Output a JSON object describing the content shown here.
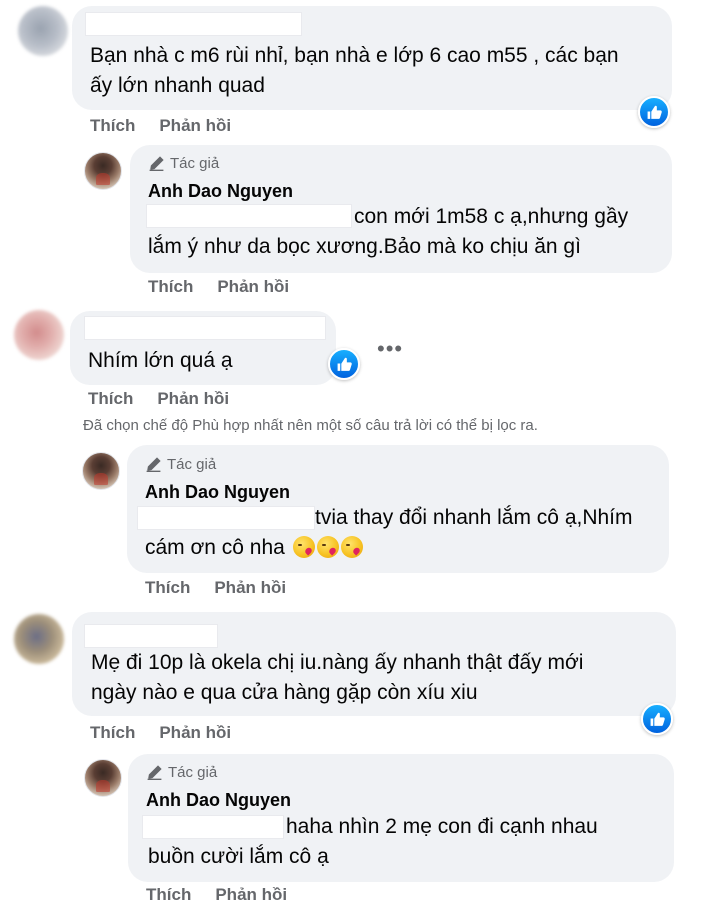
{
  "comments": [
    {
      "text_lines": [
        "Bạn nhà c m6 rùi nhỉ, bạn nhà e lớp 6 cao m55 , các bạn",
        "ấy lớn nhanh quad"
      ],
      "actions": {
        "like": "Thích",
        "reply": "Phản hồi"
      },
      "reply": {
        "badge": "Tác giả",
        "author": "Anh Dao Nguyen",
        "text_lines": [
          "con mới 1m58 c ạ,nhưng gầy",
          "lắm ý như da bọc xương.Bảo mà ko chịu ăn gì"
        ],
        "actions": {
          "like": "Thích",
          "reply": "Phản hồi"
        }
      }
    },
    {
      "text_lines": [
        "Nhím lớn quá ạ"
      ],
      "actions": {
        "like": "Thích",
        "reply": "Phản hồi"
      },
      "more": "•••",
      "filter_note": "Đã chọn chế độ Phù hợp nhất nên một số câu trả lời có thể bị lọc ra.",
      "reply": {
        "badge": "Tác giả",
        "author": "Anh Dao Nguyen",
        "text_lines": [
          "tvia thay đổi nhanh lắm cô ạ,Nhím",
          "cám ơn cô nha"
        ],
        "actions": {
          "like": "Thích",
          "reply": "Phản hồi"
        }
      }
    },
    {
      "text_lines": [
        "Mẹ đi 10p là okela chị iu.nàng ấy nhanh thật đấy mới",
        "ngày nào e qua cửa hàng gặp còn xíu xiu"
      ],
      "actions": {
        "like": "Thích",
        "reply": "Phản hồi"
      },
      "reply": {
        "badge": "Tác giả",
        "author": "Anh Dao Nguyen",
        "text_lines": [
          "haha nhìn 2 mẹ con đi cạnh nhau",
          "buồn cười lắm cô ạ"
        ],
        "actions": {
          "like": "Thích",
          "reply": "Phản hồi"
        }
      }
    }
  ],
  "icons": {
    "like": "thumbs-up-icon",
    "author": "pencil-icon",
    "emoji": "kissing-heart-emoji"
  },
  "colors": {
    "bubble": "#f0f2f5",
    "like_blue": "#1877f2",
    "secondary_text": "#65676b"
  }
}
